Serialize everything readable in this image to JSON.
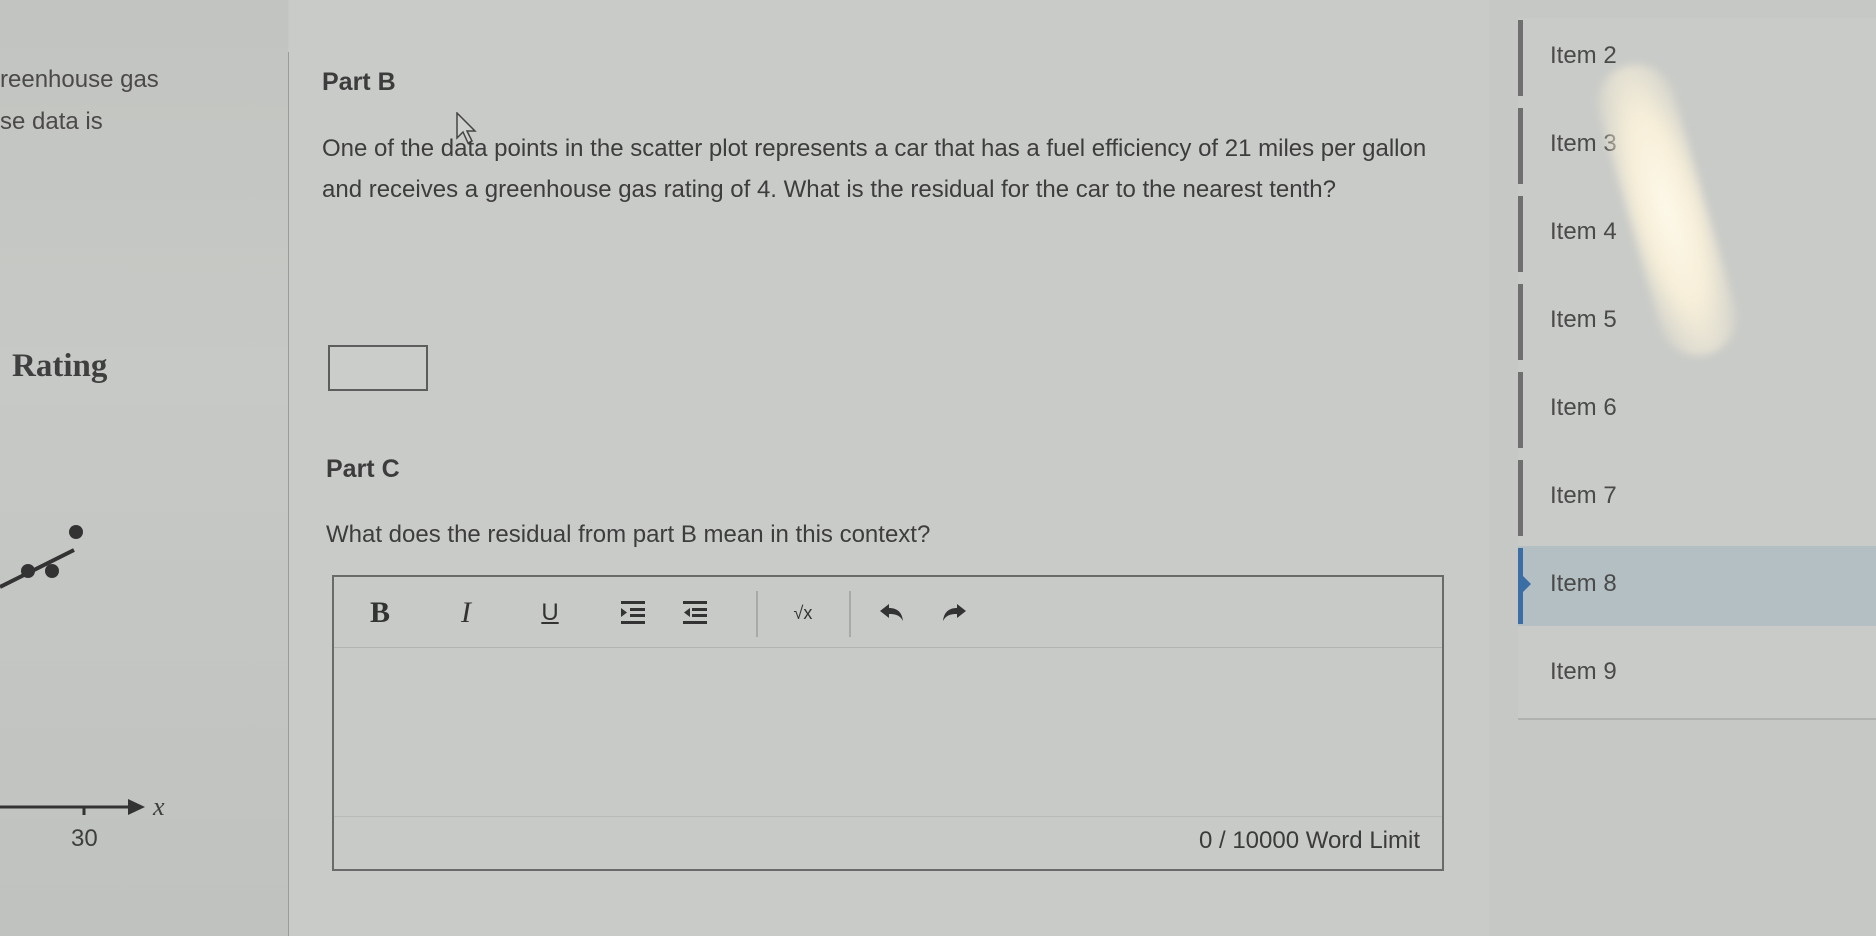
{
  "stimulus": {
    "line1_fragment": "reenhouse gas",
    "line2_fragment": "se data is",
    "plot_title_fragment": "Rating",
    "x_axis_label": "x",
    "x_tick_label": "30"
  },
  "part_b": {
    "title": "Part B",
    "question": "One of the data points in the scatter plot represents a car that has a fuel efficiency of 21 miles per gallon and receives a greenhouse gas rating of 4. What is the residual for the car to the nearest tenth?",
    "answer_value": ""
  },
  "part_c": {
    "title": "Part C",
    "question": "What does the residual from part B mean in this context?",
    "editor": {
      "toolbar": {
        "bold": "B",
        "italic": "I",
        "underline": "U",
        "indent": "indent-icon",
        "outdent": "outdent-icon",
        "math": "√x",
        "undo": "undo-icon",
        "redo": "redo-icon"
      },
      "content": "",
      "word_count": "0 / 10000 Word Limit"
    }
  },
  "sidebar": {
    "active_color": "#3a6ea5",
    "items": [
      {
        "label": "Item 2",
        "active": false
      },
      {
        "label": "Item 3",
        "active": false
      },
      {
        "label": "Item 4",
        "active": false
      },
      {
        "label": "Item 5",
        "active": false
      },
      {
        "label": "Item 6",
        "active": false
      },
      {
        "label": "Item 7",
        "active": false
      },
      {
        "label": "Item 8",
        "active": true
      },
      {
        "label": "Item 9",
        "active": false
      }
    ]
  }
}
